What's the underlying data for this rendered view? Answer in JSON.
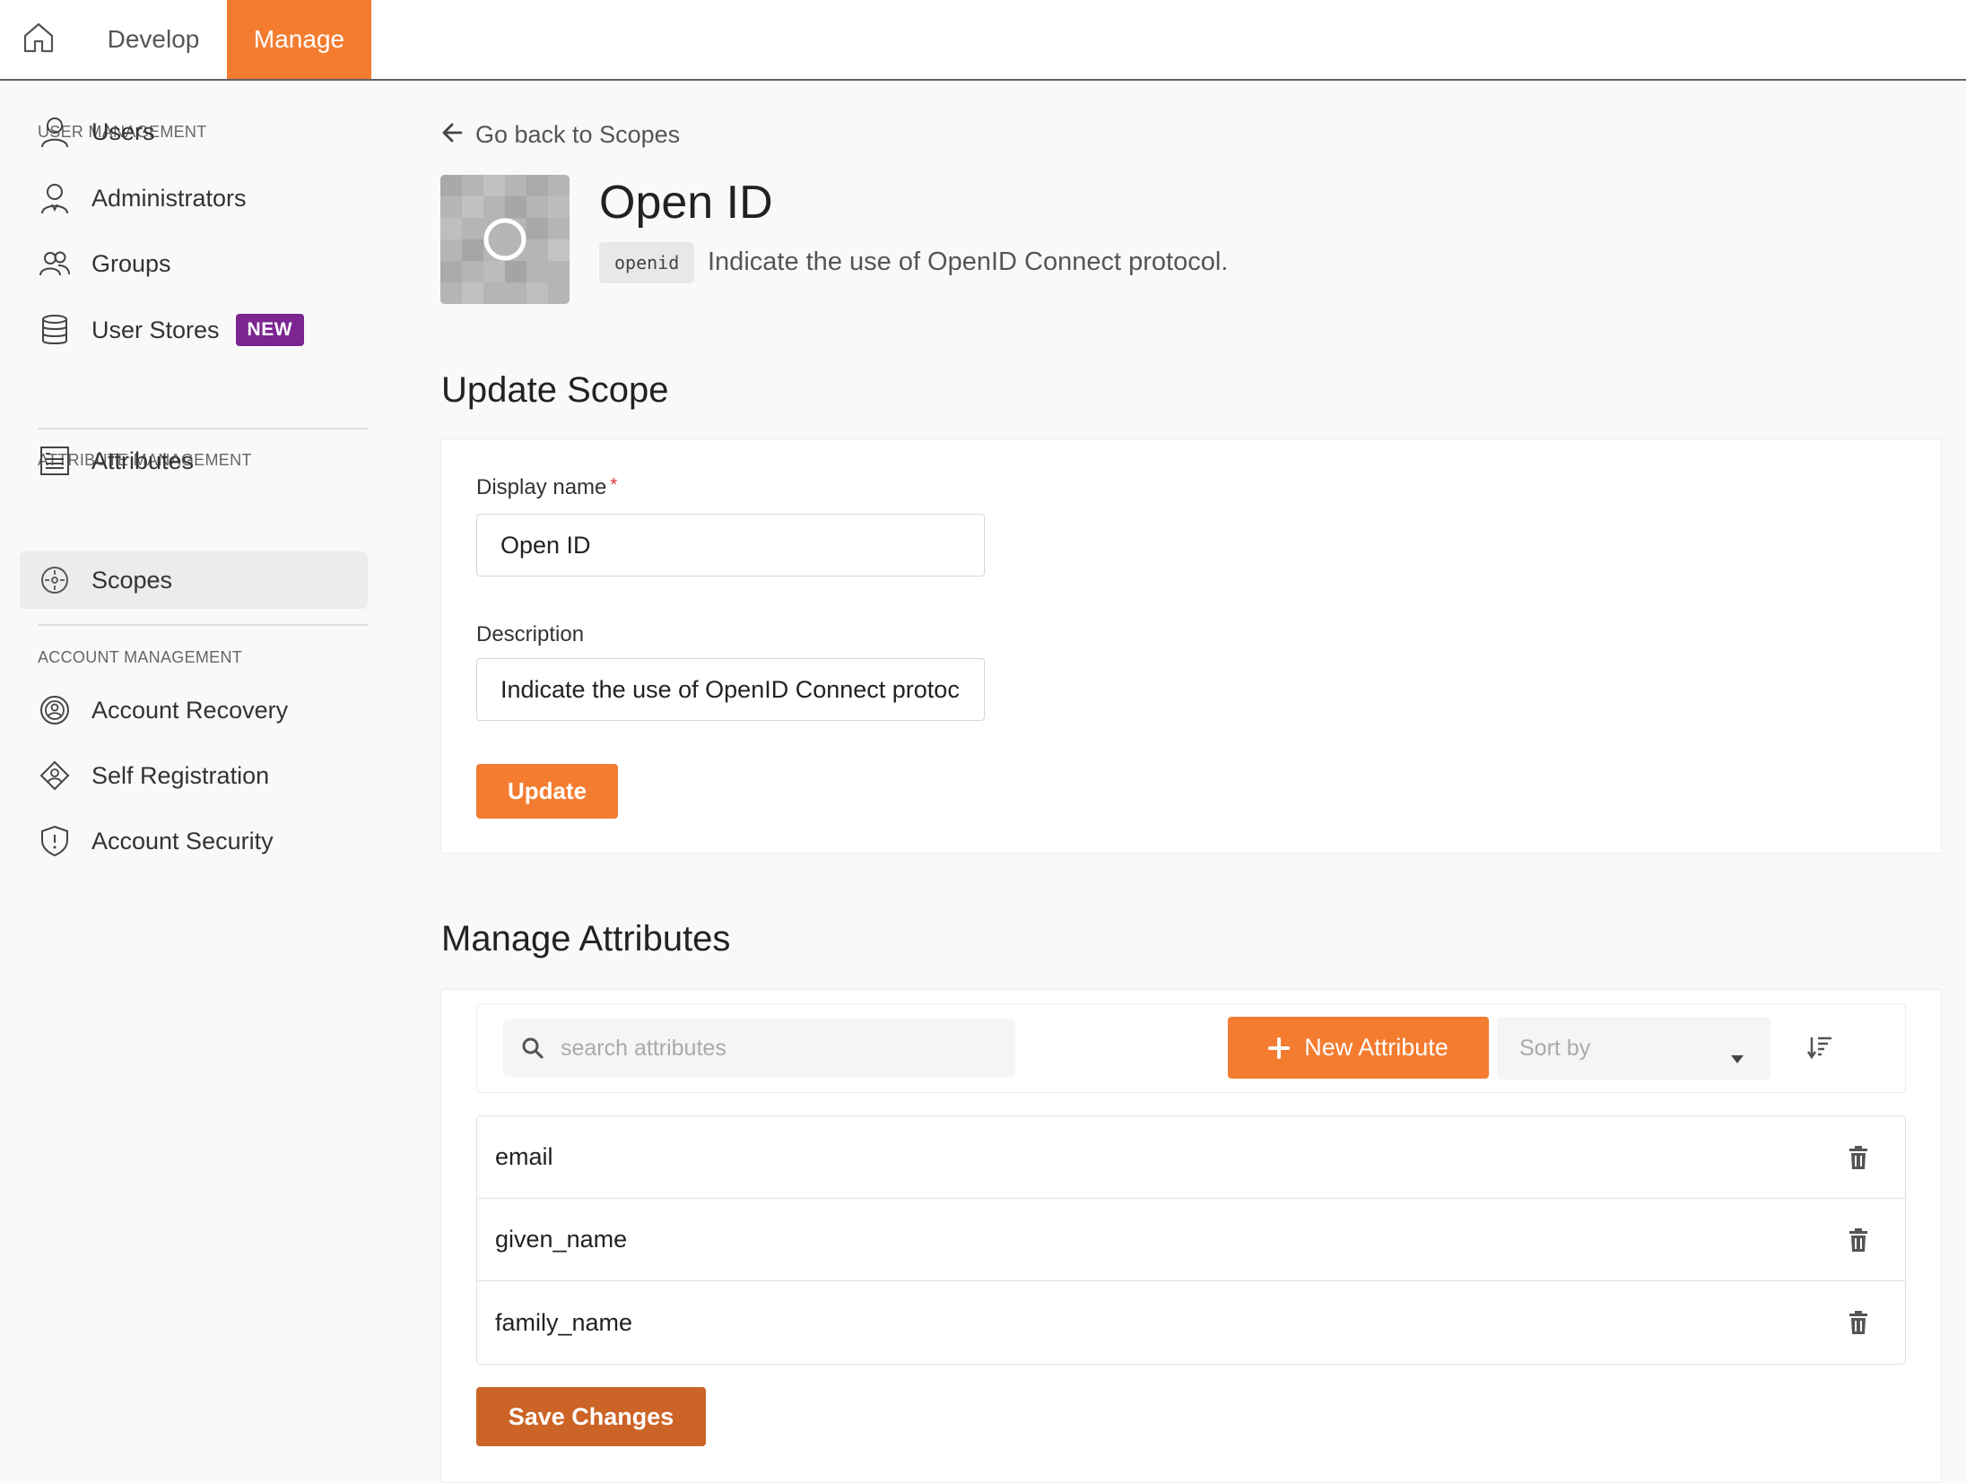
{
  "topbar": {
    "home_icon": "home-icon",
    "tabs": [
      {
        "label": "Develop",
        "active": false
      },
      {
        "label": "Manage",
        "active": true
      }
    ],
    "accent_color": "#f47c30"
  },
  "sidebar": {
    "sections": [
      {
        "title": "USER MANAGEMENT",
        "items": [
          {
            "label": "Users",
            "icon": "user-icon"
          },
          {
            "label": "Administrators",
            "icon": "admin-icon"
          },
          {
            "label": "Groups",
            "icon": "groups-icon"
          },
          {
            "label": "User Stores",
            "icon": "database-icon",
            "badge": "NEW"
          }
        ]
      },
      {
        "title": "ATTRIBUTE MANAGEMENT",
        "items": [
          {
            "label": "Attributes",
            "icon": "attributes-icon"
          },
          {
            "label": "Scopes",
            "icon": "scopes-icon",
            "active": true
          }
        ]
      },
      {
        "title": "ACCOUNT MANAGEMENT",
        "items": [
          {
            "label": "Account Recovery",
            "icon": "recovery-icon"
          },
          {
            "label": "Self Registration",
            "icon": "self-registration-icon"
          },
          {
            "label": "Account Security",
            "icon": "shield-icon"
          }
        ]
      }
    ],
    "badge_color": "#7b2591"
  },
  "main": {
    "back_link": "Go back to Scopes",
    "scope": {
      "title": "Open ID",
      "key": "openid",
      "description": "Indicate the use of OpenID Connect protocol."
    },
    "update_scope": {
      "heading": "Update Scope",
      "display_name_label": "Display name",
      "required_mark": "*",
      "display_name_value": "Open ID",
      "description_label": "Description",
      "description_value": "Indicate the use of OpenID Connect protocol.",
      "update_button": "Update"
    },
    "manage_attributes": {
      "heading": "Manage Attributes",
      "search_placeholder": "search attributes",
      "new_attribute_button": "New Attribute",
      "sort_placeholder": "Sort by",
      "attributes": [
        "email",
        "given_name",
        "family_name"
      ],
      "save_button": "Save Changes"
    }
  }
}
